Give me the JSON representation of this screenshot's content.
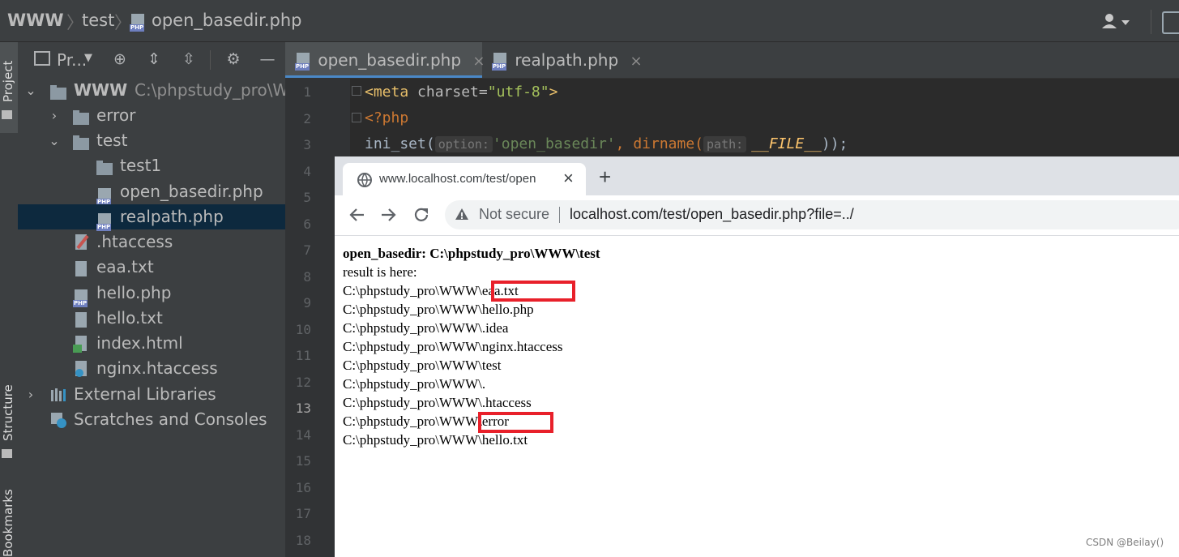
{
  "navbar": {
    "crumbs": [
      "WWW",
      "test",
      "open_basedir.php"
    ]
  },
  "stripe": {
    "project": "Project",
    "structure": "Structure",
    "bookmarks": "Bookmarks"
  },
  "project": {
    "toolbar_label": "Pr...",
    "tree": [
      {
        "label": "WWW",
        "hint": "C:\\phpstudy_pro\\W"
      },
      {
        "label": "error"
      },
      {
        "label": "test"
      },
      {
        "label": "test1"
      },
      {
        "label": "open_basedir.php"
      },
      {
        "label": "realpath.php"
      },
      {
        "label": ".htaccess"
      },
      {
        "label": "eaa.txt"
      },
      {
        "label": "hello.php"
      },
      {
        "label": "hello.txt"
      },
      {
        "label": "index.html"
      },
      {
        "label": "nginx.htaccess"
      },
      {
        "label": "External Libraries"
      },
      {
        "label": "Scratches and Consoles"
      }
    ]
  },
  "editor": {
    "tabs": [
      {
        "label": "open_basedir.php",
        "close": "×"
      },
      {
        "label": "realpath.php",
        "close": "×"
      }
    ],
    "line_numbers": [
      "1",
      "2",
      "3",
      "4",
      "5",
      "6",
      "7",
      "8",
      "9",
      "10",
      "11",
      "12",
      "13",
      "14",
      "15",
      "16",
      "17",
      "18"
    ],
    "current_line": "13",
    "code": {
      "line1_tag": "<meta",
      "line1_attr": " charset=",
      "line1_val": "\"utf-8\"",
      "line1_end": ">",
      "line2": "<?php",
      "line3_fn": "ini_set(",
      "line3_hint1": "option:",
      "line3_arg1": "'open_basedir'",
      "line3_mid": ", dirname(",
      "line3_hint2": "path:",
      "line3_arg2": "__FILE__",
      "line3_end": "));"
    }
  },
  "browser": {
    "tab_title": "www.localhost.com/test/open",
    "tab_close": "×",
    "new_tab": "+",
    "security": "Not secure",
    "url": "localhost.com/test/open_basedir.php?file=../",
    "content": {
      "heading": "open_basedir: C:\\phpstudy_pro\\WWW\\test",
      "lines": [
        "result is here:",
        "C:\\phpstudy_pro\\WWW\\eaa.txt",
        "C:\\phpstudy_pro\\WWW\\hello.php",
        "C:\\phpstudy_pro\\WWW\\.idea",
        "C:\\phpstudy_pro\\WWW\\nginx.htaccess",
        "C:\\phpstudy_pro\\WWW\\test",
        "C:\\phpstudy_pro\\WWW\\.",
        "C:\\phpstudy_pro\\WWW\\.htaccess",
        "C:\\phpstudy_pro\\WWW\\error",
        "C:\\phpstudy_pro\\WWW\\hello.txt"
      ]
    }
  },
  "watermark": "CSDN @Beilay()",
  "colors": {
    "ide_panel": "#3c3f41",
    "editor_bg": "#2b2b2b",
    "selection": "#0d293e",
    "highlight_box": "#e8202a",
    "keyword_orange": "#cc7832",
    "string_green": "#6a8759",
    "tag_yellow": "#e8bf6a"
  }
}
